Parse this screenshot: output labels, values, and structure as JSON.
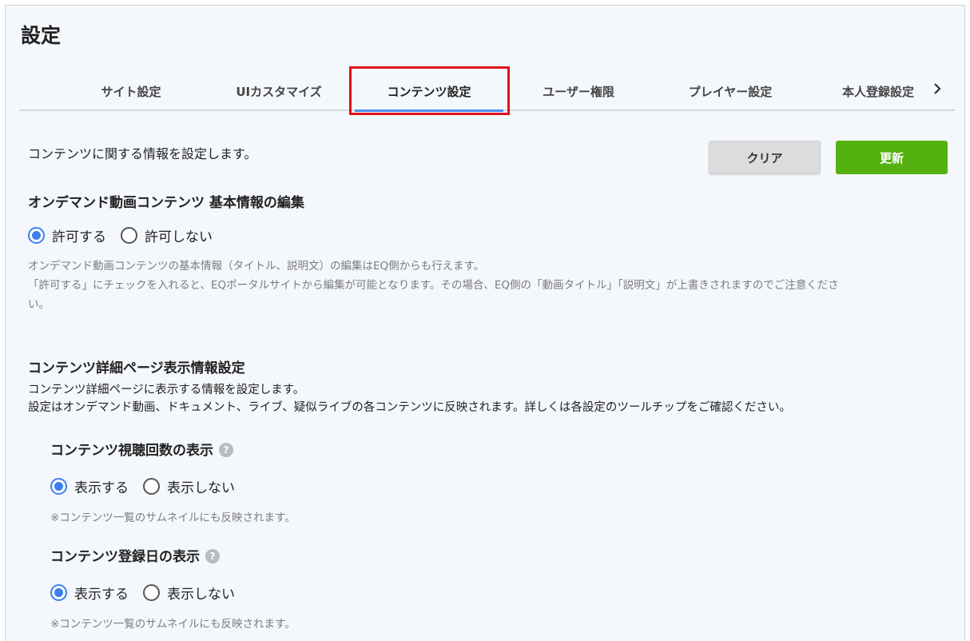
{
  "page": {
    "title": "設定"
  },
  "tabs": [
    {
      "label": "サイト設定",
      "active": false
    },
    {
      "label": "UIカスタマイズ",
      "active": false
    },
    {
      "label": "コンテンツ設定",
      "active": true
    },
    {
      "label": "ユーザー権限",
      "active": false
    },
    {
      "label": "プレイヤー設定",
      "active": false
    },
    {
      "label": "本人登録設定",
      "active": false
    }
  ],
  "header": {
    "intro": "コンテンツに関する情報を設定します。",
    "clear_label": "クリア",
    "update_label": "更新"
  },
  "ondemand": {
    "title": "オンデマンド動画コンテンツ 基本情報の編集",
    "options": [
      "許可する",
      "許可しない"
    ],
    "selected": "許可する",
    "note_line1": "オンデマンド動画コンテンツの基本情報（タイトル、説明文）の編集はEQ側からも行えます。",
    "note_line2": "「許可する」にチェックを入れると、EQポータルサイトから編集が可能となります。その場合、EQ側の「動画タイトル」「説明文」が上書きされますのでご注意くださ",
    "note_line3": "い。"
  },
  "detail": {
    "title": "コンテンツ詳細ページ表示情報設定",
    "desc_line1": "コンテンツ詳細ページに表示する情報を設定します。",
    "desc_line2": "設定はオンデマンド動画、ドキュメント、ライブ、疑似ライブの各コンテンツに反映されます。詳しくは各設定のツールチップをご確認ください。",
    "view_count": {
      "title": "コンテンツ視聴回数の表示",
      "options": [
        "表示する",
        "表示しない"
      ],
      "selected": "表示する",
      "note": "※コンテンツ一覧のサムネイルにも反映されます。"
    },
    "reg_date": {
      "title": "コンテンツ登録日の表示",
      "options": [
        "表示する",
        "表示しない"
      ],
      "selected": "表示する",
      "note": "※コンテンツ一覧のサムネイルにも反映されます。"
    }
  },
  "colors": {
    "accent": "#3d7ff0",
    "update_button": "#54b10f",
    "highlight_box": "#e0101b"
  }
}
